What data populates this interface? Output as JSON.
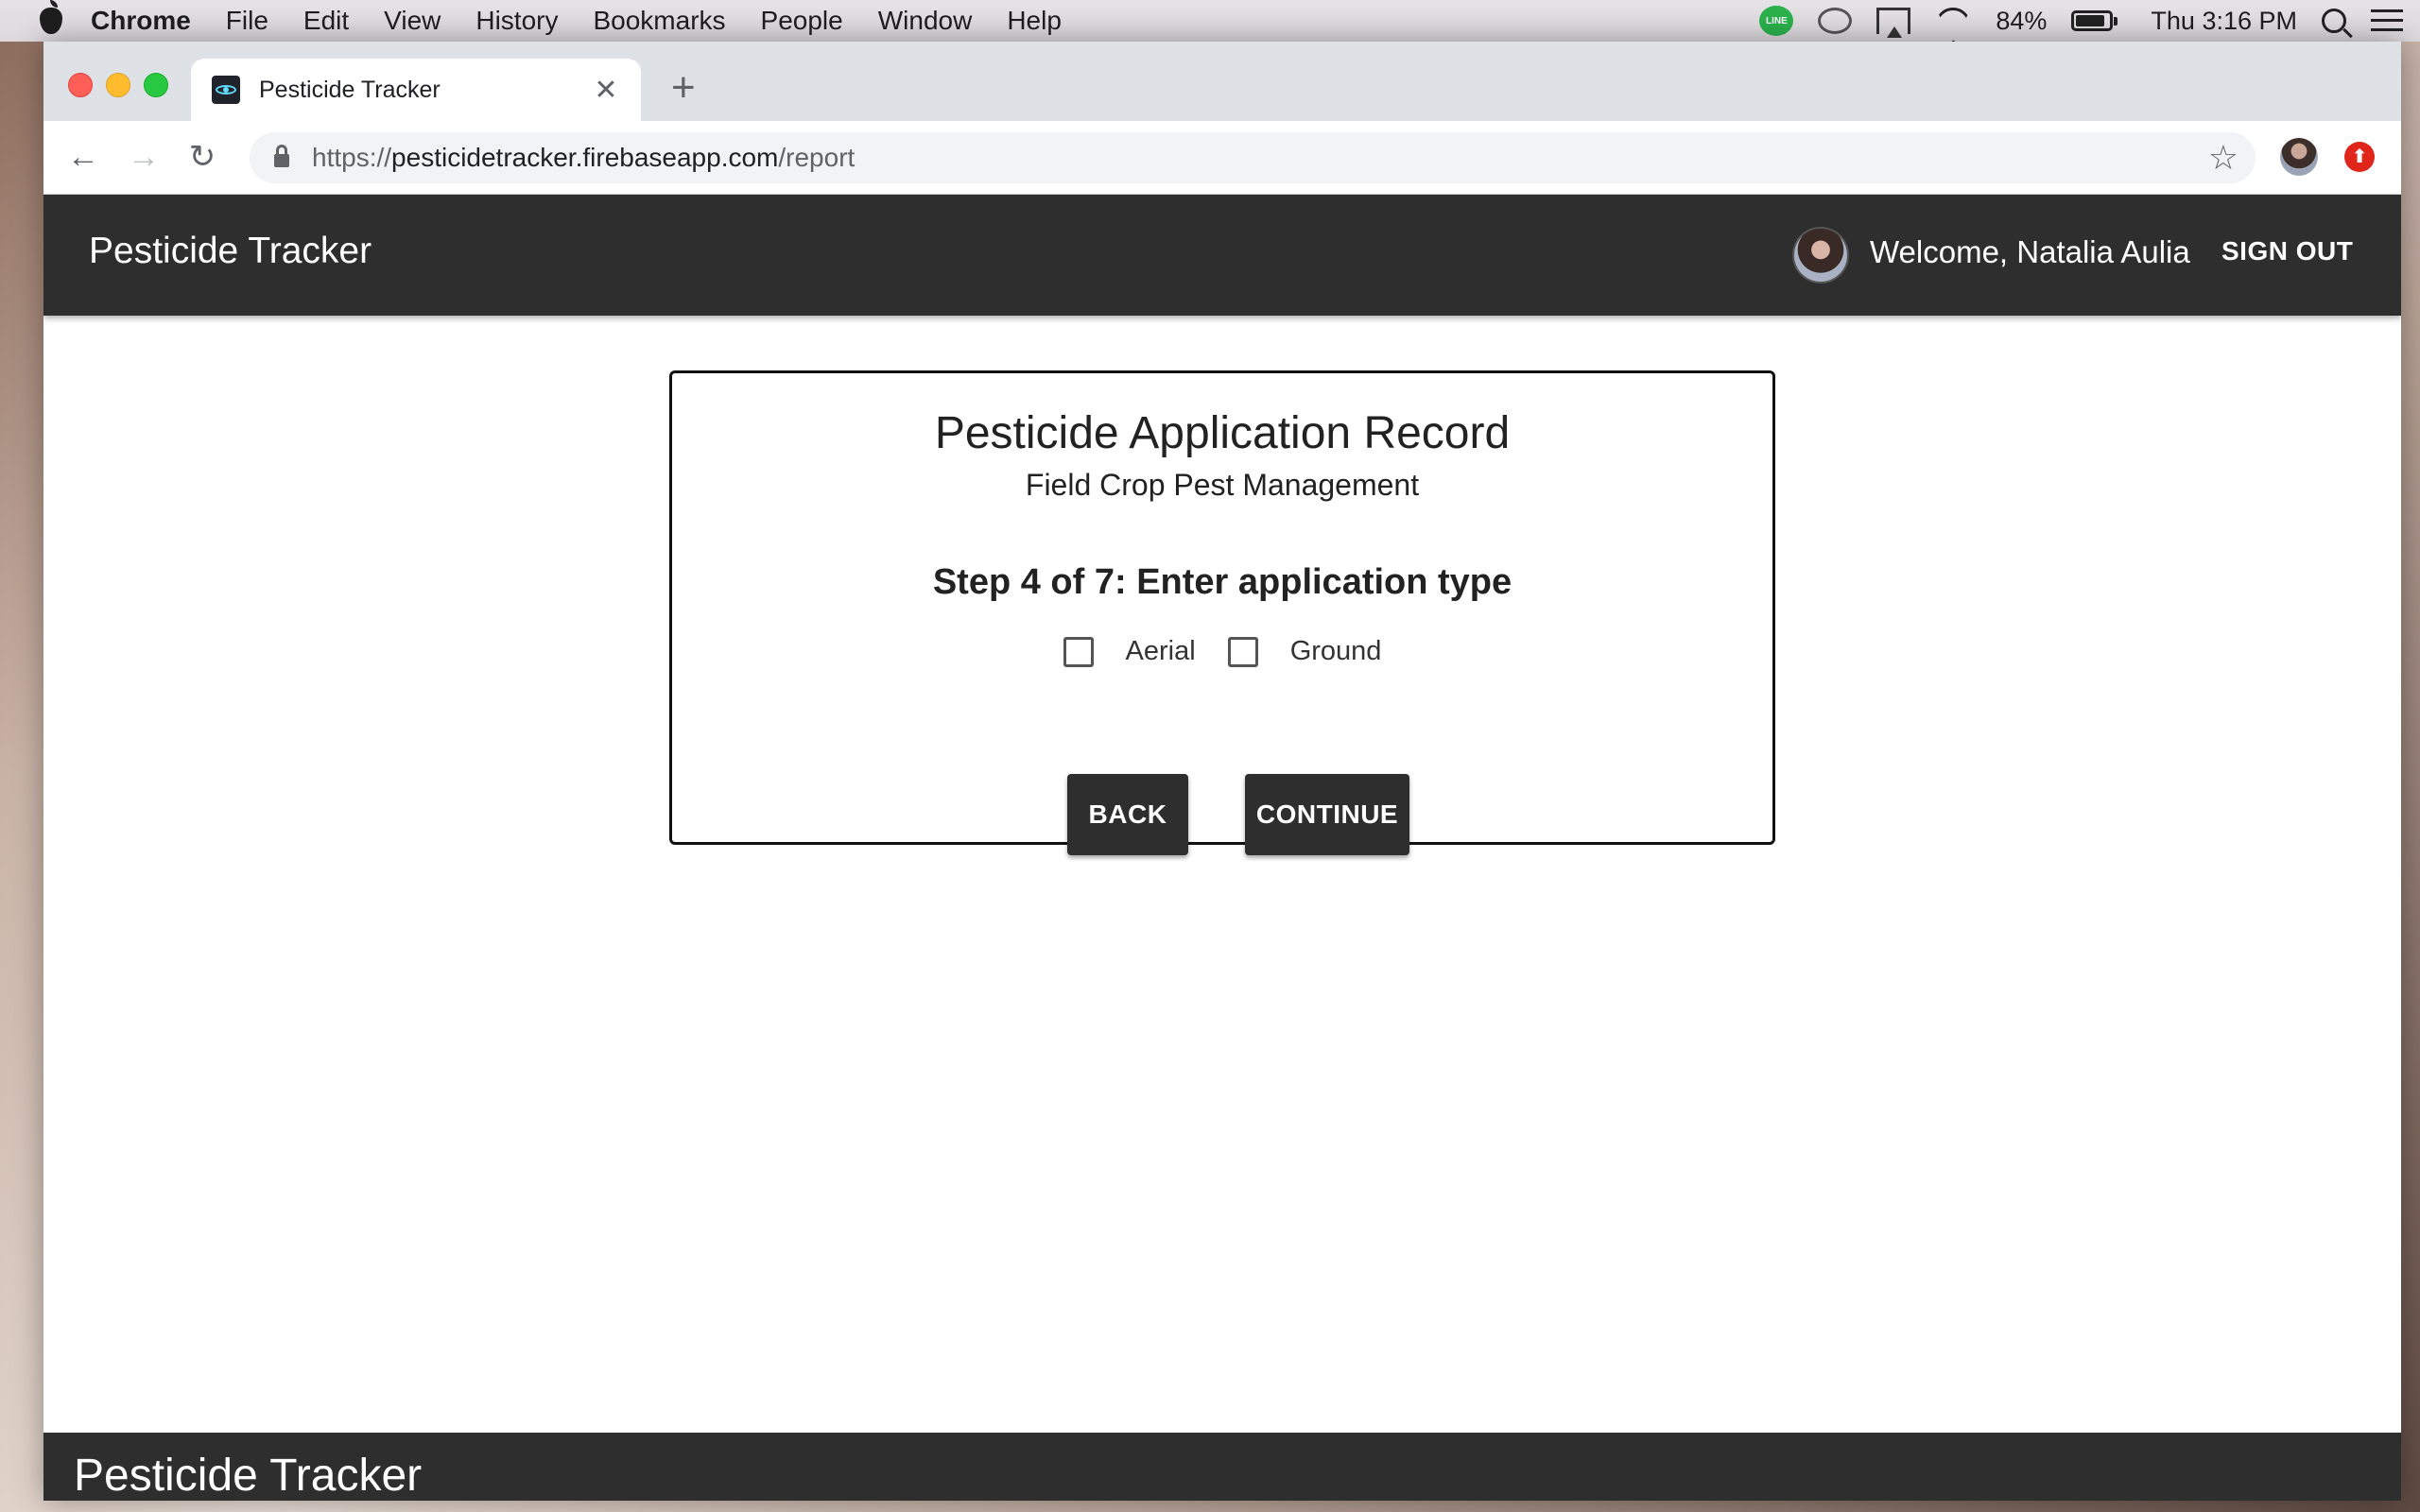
{
  "menubar": {
    "items": [
      "Chrome",
      "File",
      "Edit",
      "View",
      "History",
      "Bookmarks",
      "People",
      "Window",
      "Help"
    ],
    "battery": "84%",
    "clock": "Thu 3:16 PM",
    "line_badge": "LINE"
  },
  "browser": {
    "tab_title": "Pesticide Tracker",
    "url_scheme": "https://",
    "url_host": "pesticidetracker.firebaseapp.com",
    "url_path": "/report"
  },
  "app": {
    "title": "Pesticide Tracker",
    "welcome": "Welcome, Natalia Aulia",
    "sign_out": "SIGN OUT"
  },
  "form": {
    "title": "Pesticide Application Record",
    "subtitle": "Field Crop Pest Management",
    "step": "Step 4 of 7: Enter application type",
    "options": [
      {
        "label": "Aerial",
        "checked": false
      },
      {
        "label": "Ground",
        "checked": false
      }
    ],
    "back_label": "BACK",
    "continue_label": "CONTINUE"
  },
  "footer": {
    "title": "Pesticide Tracker"
  }
}
